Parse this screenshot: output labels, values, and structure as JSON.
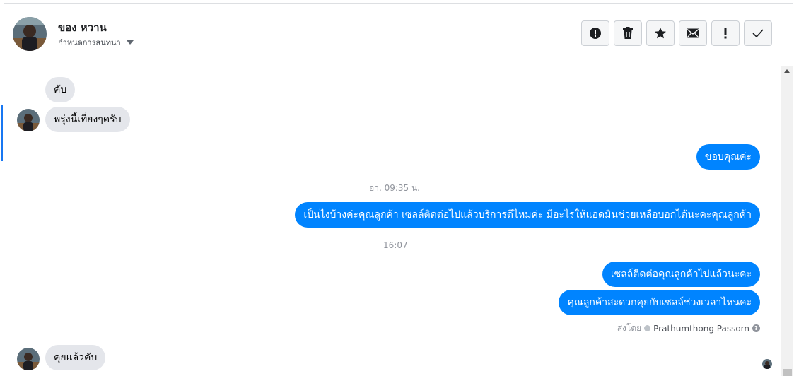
{
  "header": {
    "contact_name": "ของ หวาน",
    "assign_label": "กำหนดการสนทนา",
    "actions": [
      {
        "icon": "alert-circle-icon"
      },
      {
        "icon": "trash-icon"
      },
      {
        "icon": "star-icon"
      },
      {
        "icon": "envelope-icon"
      },
      {
        "icon": "exclamation-icon"
      },
      {
        "icon": "checkmark-icon"
      }
    ]
  },
  "messages": {
    "m1": "คับ",
    "m2": "พรุ่งนี้เที่ยงๆครับ",
    "m3": "ขอบคุณค่ะ",
    "ts1": "อา. 09:35 น.",
    "m4": "เป็นไงบ้างค่ะคุณลูกค้า เซลล์ติดต่อไปแล้วบริการดีไหมค่ะ มีอะไรให้แอดมินช่วยเหลือบอกได้นะคะคุณลูกค้า",
    "ts2": "16:07",
    "m5": "เซลล์ติดต่อคุณลูกค้าไปแล้วนะคะ",
    "m6": "คุณลูกค้าสะดวกคุยกับเซลล์ช่วงเวลาไหนคะ",
    "sent_by_label": "ส่งโดย",
    "sent_by_name": "Prathumthong Passorn",
    "m7": "คุยแล้วคับ"
  },
  "colors": {
    "outgoing_bubble": "#0084ff",
    "incoming_bubble": "#e4e6eb",
    "accent": "#1877f2"
  }
}
